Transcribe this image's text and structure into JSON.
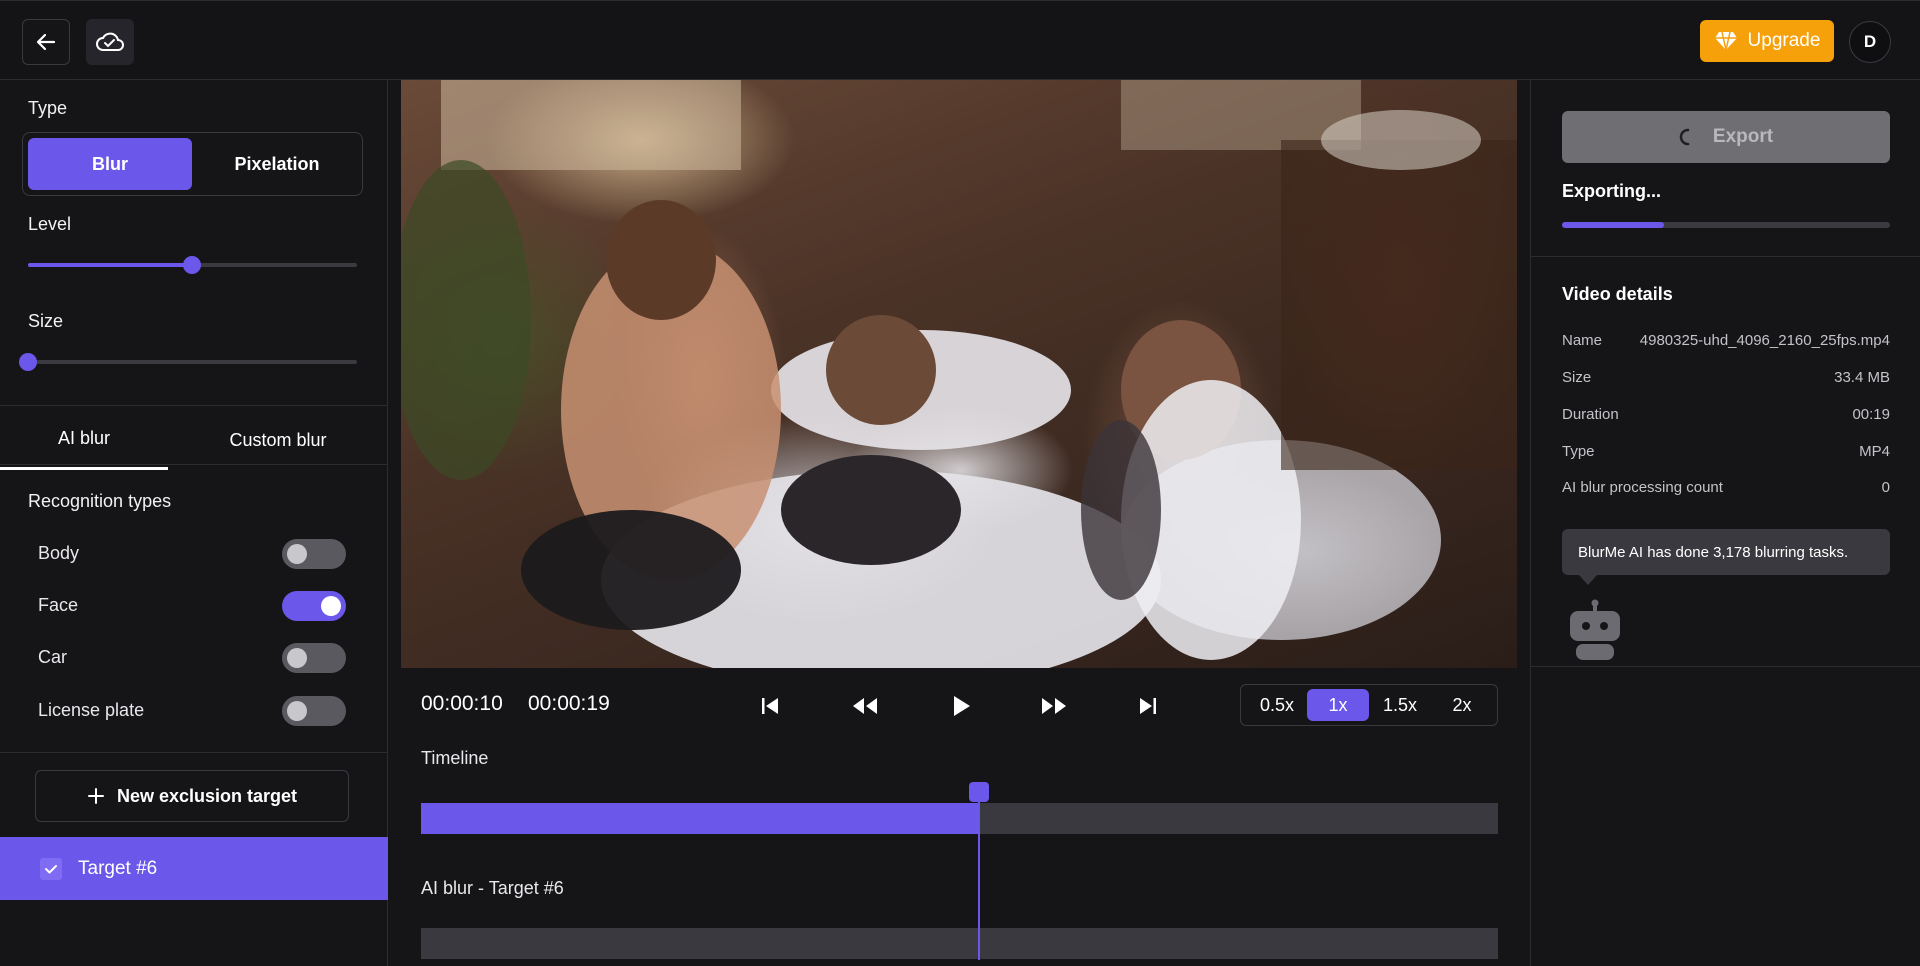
{
  "header": {
    "upgrade_label": "Upgrade",
    "avatar_initial": "D"
  },
  "left": {
    "type_label": "Type",
    "type_options": [
      "Blur",
      "Pixelation"
    ],
    "type_selected": "Blur",
    "level_label": "Level",
    "level_value": 0.5,
    "size_label": "Size",
    "size_value": 0.0,
    "tabs": [
      "AI blur",
      "Custom blur"
    ],
    "active_tab": "AI blur",
    "recognition_label": "Recognition types",
    "recognition_types": [
      {
        "label": "Body",
        "on": false
      },
      {
        "label": "Face",
        "on": true
      },
      {
        "label": "Car",
        "on": false
      },
      {
        "label": "License plate",
        "on": false
      }
    ],
    "new_exclusion_label": "New exclusion target",
    "target_label": "Target #6"
  },
  "player": {
    "current_time": "00:00:10",
    "total_time": "00:00:19",
    "speeds": [
      "0.5x",
      "1x",
      "1.5x",
      "2x"
    ],
    "active_speed": "1x",
    "timeline_label": "Timeline",
    "timeline_progress": 0.52,
    "track_label": "AI blur - Target #6"
  },
  "right": {
    "export_label": "Export",
    "exporting_label": "Exporting...",
    "export_progress": 0.31,
    "video_details_title": "Video details",
    "details": [
      {
        "key": "Name",
        "value": "4980325-uhd_4096_2160_25fps.mp4"
      },
      {
        "key": "Size",
        "value": "33.4 MB"
      },
      {
        "key": "Duration",
        "value": "00:19"
      },
      {
        "key": "Type",
        "value": "MP4"
      },
      {
        "key": "AI blur processing count",
        "value": "0"
      }
    ],
    "tip_text": "BlurMe AI has done 3,178 blurring tasks."
  },
  "colors": {
    "accent": "#6b57e9",
    "upgrade": "#f6a00a",
    "background": "#151417"
  },
  "icons": [
    "arrow-left-icon",
    "cloud-check-icon",
    "diamond-icon",
    "check-icon",
    "plus-icon",
    "skip-back-icon",
    "rewind-icon",
    "play-icon",
    "fast-forward-icon",
    "skip-forward-icon",
    "spinner-icon",
    "robot-icon"
  ]
}
